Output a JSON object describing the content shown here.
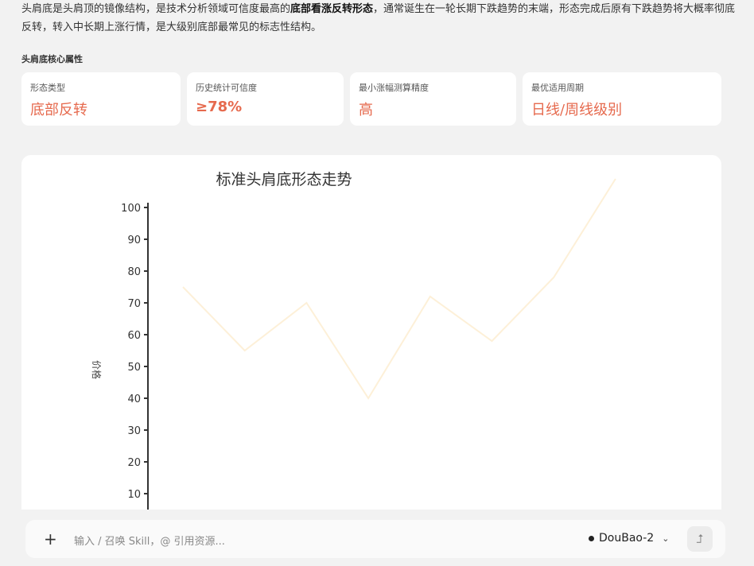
{
  "intro": {
    "part1": "头肩底是头肩顶的镜像结构，是技术分析领域可信度最高的",
    "highlight": "底部看涨反转形态",
    "part2": "，通常诞生在一轮长期下跌趋势的末端，形态完成后原有下跌趋势将大概率彻底反转，转入中长期上涨行情，是大级别底部最常见的标志性结构。"
  },
  "section_title": "头肩底核心属性",
  "cards": [
    {
      "label": "形态类型",
      "value": "底部反转"
    },
    {
      "label": "历史统计可信度",
      "value": "≥78%"
    },
    {
      "label": "最小涨幅测算精度",
      "value": "高"
    },
    {
      "label": "最优适用周期",
      "value": "日线/周线级别"
    }
  ],
  "chart_data": {
    "type": "line",
    "title": "标准头肩底形态走势",
    "ylabel": "价格",
    "ylim": [
      0,
      105
    ],
    "yticks": [
      10,
      20,
      30,
      40,
      50,
      60,
      70,
      80,
      90,
      100
    ],
    "x": [
      0,
      1,
      2,
      3,
      4,
      5,
      6,
      7
    ],
    "series": [
      {
        "values": [
          75,
          55,
          70,
          40,
          72,
          58,
          78,
          109
        ],
        "color": "#fdf0d8"
      }
    ]
  },
  "input": {
    "plus": "+",
    "placeholder": "输入 / 召唤 Skill，@ 引用资源...",
    "model": "DouBao-2",
    "chev": "⌄",
    "send": "⮥"
  }
}
